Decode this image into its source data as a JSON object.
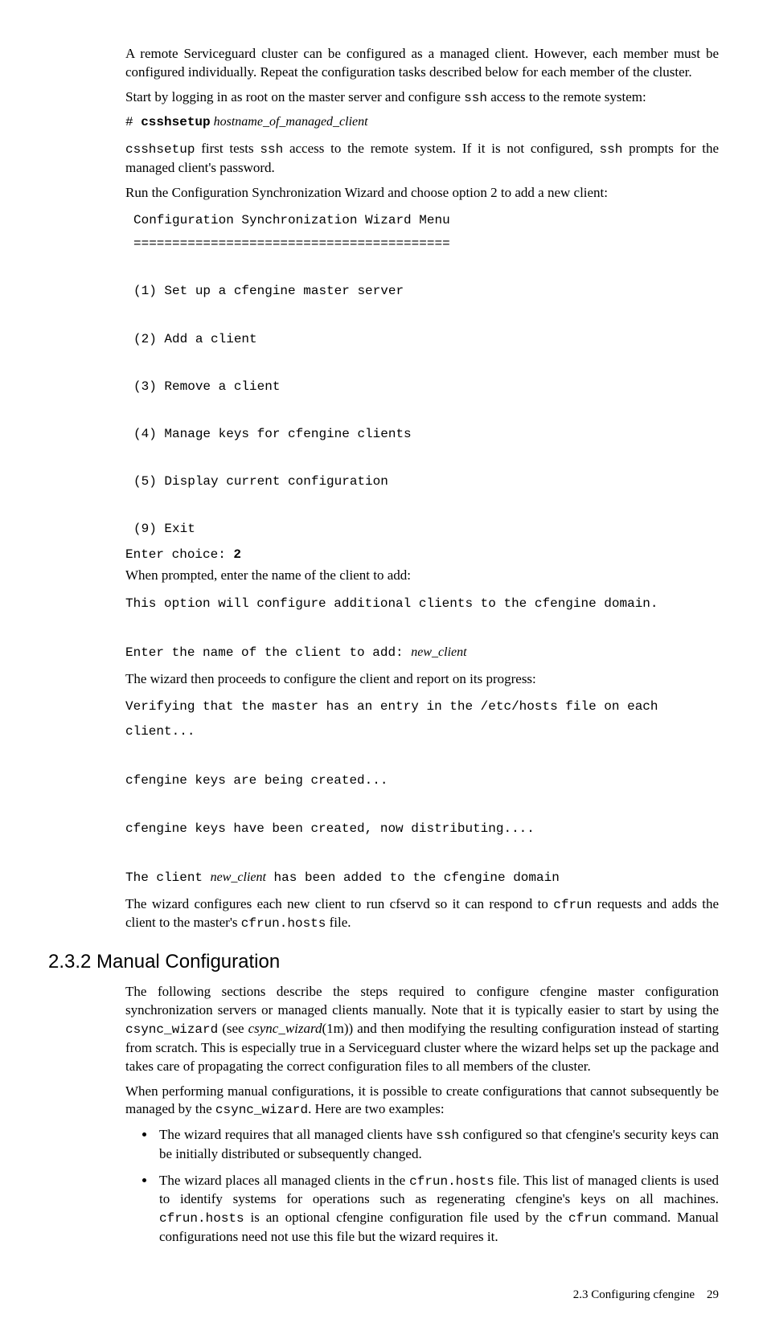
{
  "para1": "A remote Serviceguard cluster can be configured as a managed client. However, each member must be configured individually. Repeat the configuration tasks described below for each member of the cluster.",
  "para2_a": "Start by logging in as root on the master server and configure ",
  "para2_code": "ssh",
  "para2_b": " access to the remote system:",
  "cmd_prefix": "# ",
  "cmd_bold": "csshsetup",
  "cmd_ital": " hostname_of_managed_client",
  "para3_a": "csshsetup",
  "para3_b": " first tests ",
  "para3_c": "ssh",
  "para3_d": " access to the remote system. If it is not configured, ",
  "para3_e": "ssh",
  "para3_f": " prompts for the managed client's password.",
  "para4": "Run the Configuration Synchronization Wizard and choose option 2 to add a new client:",
  "menu": "Configuration Synchronization Wizard Menu\n=========================================\n\n(1) Set up a cfengine master server\n\n(2) Add a client\n\n(3) Remove a client\n\n(4) Manage keys for cfengine clients\n\n(5) Display current configuration\n\n(9) Exit",
  "enter_label": "Enter choice: ",
  "enter_val": "2",
  "para5": "When prompted, enter the name of the client to add:",
  "block2_a": "This option will configure additional clients to the cfengine domain.\n\nEnter the name of the client to add: ",
  "block2_ital": "new_client",
  "para6": "The wizard then proceeds to configure the client and report on its progress:",
  "block3_a": "Verifying that the master has an entry in the /etc/hosts file on each client...\n\ncfengine keys are being created...\n\ncfengine keys have been created, now distributing....\n\nThe client ",
  "block3_ital": "new_client",
  "block3_b": " has been added to the cfengine domain",
  "para7_a": "The wizard configures each new client to run cfservd so it can respond to ",
  "para7_code1": "cfrun",
  "para7_b": " requests and adds the client to the master's ",
  "para7_code2": "cfrun.hosts",
  "para7_c": " file.",
  "h2": "2.3.2 Manual Configuration",
  "para8_a": "The following sections describe the steps required to configure cfengine master configuration synchronization servers or managed clients manually. Note that it is typically easier to start by using the ",
  "para8_code": "csync_wizard",
  "para8_b": " (see ",
  "para8_ital": "csync_wizard",
  "para8_c": "(1m)) and then modifying the resulting configuration instead of starting from scratch. This is especially true in a Serviceguard cluster where the wizard helps set up the package and takes care of propagating the correct configuration files to all members of the cluster.",
  "para9_a": "When performing manual configurations, it is possible to create configurations that cannot subsequently be managed by the ",
  "para9_code": "csync_wizard",
  "para9_b": ". Here are two examples:",
  "bullet1_a": "The wizard requires that all managed clients have ",
  "bullet1_code": "ssh",
  "bullet1_b": " configured so that cfengine's security keys can be initially distributed or subsequently changed.",
  "bullet2_a": "The wizard places all managed clients in the ",
  "bullet2_code1": "cfrun.hosts",
  "bullet2_b": " file. This list of managed clients is used to identify systems for operations such as regenerating cfengine's keys on all machines. ",
  "bullet2_code2": "cfrun.hosts",
  "bullet2_c": " is an optional cfengine configuration file used by the ",
  "bullet2_code3": "cfrun",
  "bullet2_d": " command. Manual configurations need not use this file but the wizard requires it.",
  "footer_label": "2.3 Configuring cfengine",
  "footer_page": "29"
}
